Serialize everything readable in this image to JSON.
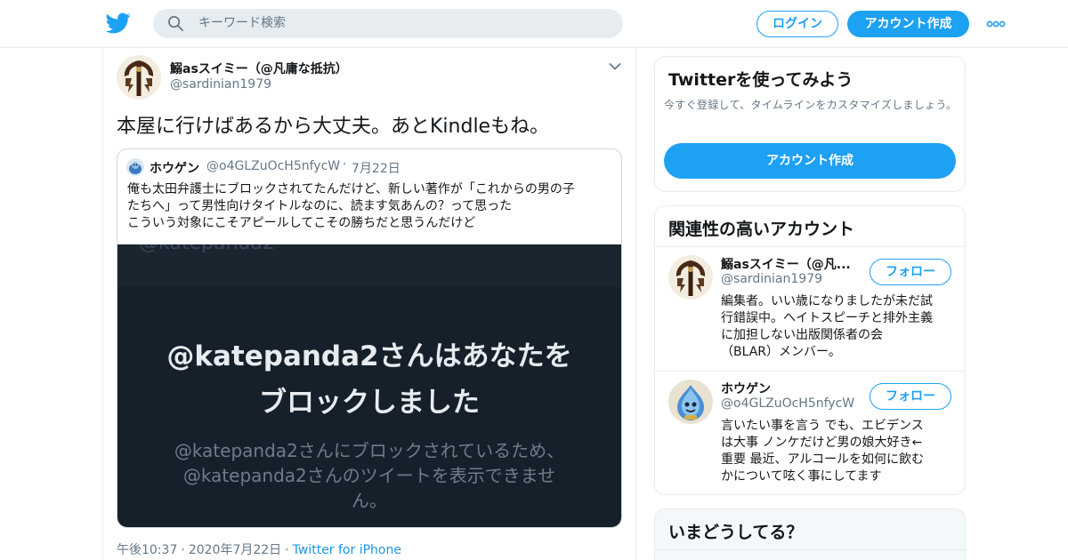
{
  "header": {
    "logo_icon": "twitter-bird-icon",
    "search_placeholder": "キーワード検索",
    "login_label": "ログイン",
    "signup_label": "アカウント作成",
    "more_icon": "more-dots-icon",
    "accent_color": "#1da1f2"
  },
  "tweet": {
    "author_name": "鰯asスイミー（@凡庸な抵抗）",
    "author_handle": "@sardinian1979",
    "text": "本屋に行けばあるから大丈夫。あとKindleもね。",
    "timestamp": "午後10:37",
    "date": "2020年7月22日",
    "source": "Twitter for iPhone",
    "quote": {
      "name": "ホウゲン",
      "handle": "@o4GLZuOcH5nfycW",
      "date": "7月22日",
      "lines": [
        "俺も太田弁護士にブロックされてたんだけど、新しい著作が「これからの男の子",
        "たちへ」って男性向けタイトルなのに、読ます気あんの？って思った",
        "こういう対象にこそアピールしてこその勝ちだと思うんだけど"
      ],
      "image": {
        "top_text": "@katepanda2",
        "big_line1": "@katepanda2さんはあなたを",
        "big_line2": "ブロックしました",
        "small_line1": "@katepanda2さんにブロックされているため、",
        "small_line2": "@katepanda2さんのツイートを表示できませ",
        "small_line3": "ん。"
      }
    }
  },
  "signup_card": {
    "title": "Twitterを使ってみよう",
    "description": "今すぐ登録して、タイムラインをカスタマイズしましょう。",
    "button": "アカウント作成"
  },
  "related": {
    "title": "関連性の高いアカウント",
    "accounts": [
      {
        "name": "鰯asスイミー（@凡...",
        "handle": "@sardinian1979",
        "follow": "フォロー",
        "bio": [
          "編集者。いい歳になりましたが未だ試",
          "行錯誤中。ヘイトスピーチと排外主義",
          "に加担しない出版関係者の会",
          "（BLAR）メンバー。"
        ]
      },
      {
        "name": "ホウゲン",
        "handle": "@o4GLZuOcH5nfycW",
        "follow": "フォロー",
        "bio": [
          "言いたい事を言う でも、エビデンス",
          "は大事 ノンケだけど男の娘大好き←",
          "重要 最近、アルコールを如何に飲む",
          "かについて呟く事にしてます"
        ]
      }
    ]
  },
  "trends": {
    "title": "いまどうしてる？"
  }
}
